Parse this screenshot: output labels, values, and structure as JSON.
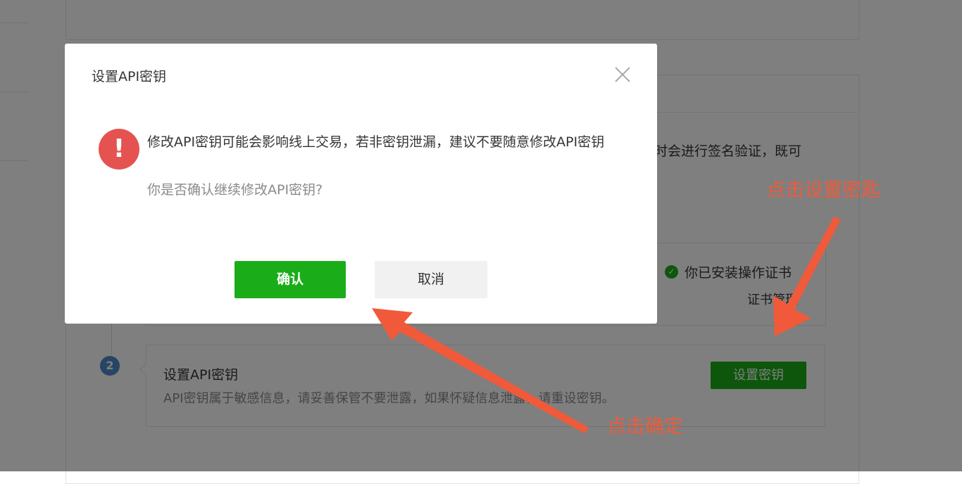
{
  "background": {
    "section_desc": "时会进行签名验证，既可",
    "cert": {
      "status_text": "你已安装操作证书",
      "manage_link": "证书管理"
    },
    "step_number": "2",
    "api_key": {
      "title": "设置API密钥",
      "description": "API密钥属于敏感信息，请妥善保管不要泄露，如果怀疑信息泄露，请重设密钥。",
      "button_label": "设置密钥"
    }
  },
  "dialog": {
    "title": "设置API密钥",
    "message": "修改API密钥可能会影响线上交易，若非密钥泄漏，建议不要随意修改API密钥",
    "question": "你是否确认继续修改API密钥?",
    "confirm_label": "确认",
    "cancel_label": "取消"
  },
  "annotations": {
    "click_set_key": "点击设置密匙",
    "click_confirm": "点击确定"
  },
  "colors": {
    "accent": "#1aad19",
    "warning": "#e55350",
    "annotation": "#f05a3a"
  }
}
